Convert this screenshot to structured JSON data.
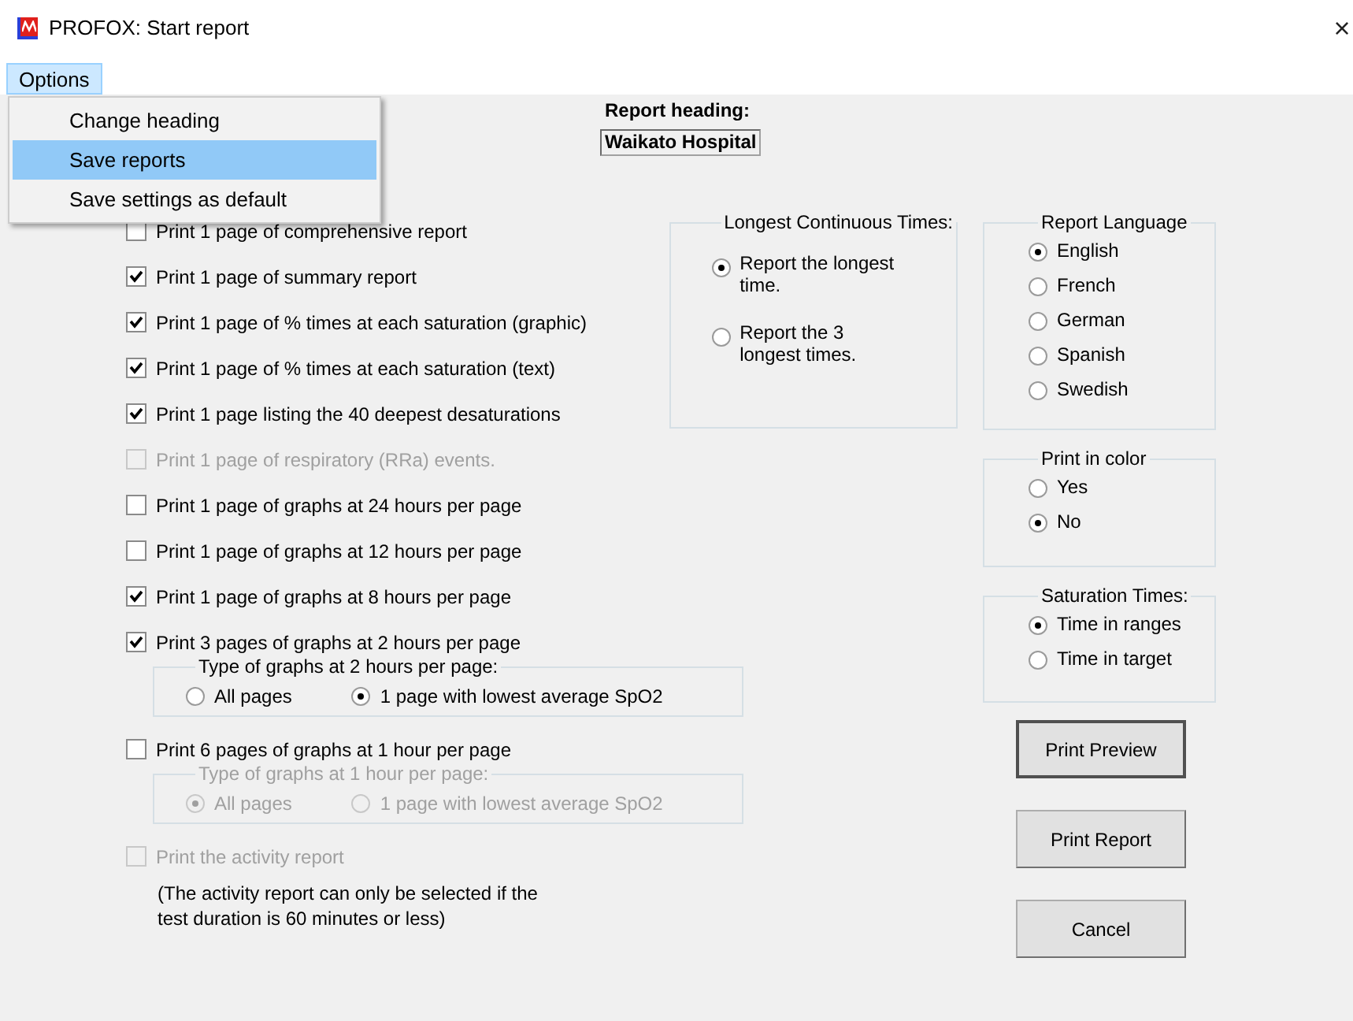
{
  "window": {
    "title": "PROFOX: Start report",
    "close": "×"
  },
  "menu_bar": [
    {
      "label": "Options",
      "selected": true
    }
  ],
  "menu": {
    "items": [
      {
        "label": "Change heading",
        "selected": false
      },
      {
        "label": "Save reports",
        "selected": true
      },
      {
        "label": "Save settings as default",
        "selected": false
      }
    ]
  },
  "report_heading": {
    "label": "Report heading:",
    "value": "Waikato Hospital"
  },
  "print_options": [
    {
      "kind": "checkbox",
      "label": "Print 1 page of comprehensive report",
      "checked": false,
      "disabled": false
    },
    {
      "kind": "checkbox",
      "label": "Print 1 page of summary report",
      "checked": true,
      "disabled": false
    },
    {
      "kind": "checkbox",
      "label": "Print 1 page of % times at each saturation (graphic)",
      "checked": true,
      "disabled": false
    },
    {
      "kind": "checkbox",
      "label": "Print 1 page of % times at each saturation (text)",
      "checked": true,
      "disabled": false
    },
    {
      "kind": "checkbox",
      "label": "Print 1 page listing the 40 deepest desaturations",
      "checked": true,
      "disabled": false
    },
    {
      "kind": "checkbox",
      "label": "Print 1 page of respiratory (RRa) events.",
      "checked": false,
      "disabled": true
    },
    {
      "kind": "checkbox",
      "label": "Print 1 page of graphs at 24 hours per page",
      "checked": false,
      "disabled": false
    },
    {
      "kind": "checkbox",
      "label": "Print 1 page of graphs at 12 hours per page",
      "checked": false,
      "disabled": false
    },
    {
      "kind": "checkbox",
      "label": "Print 1 page of graphs at 8 hours per page",
      "checked": true,
      "disabled": false
    },
    {
      "kind": "checkbox",
      "label": "Print 3 pages of graphs at 2 hours per page",
      "checked": true,
      "disabled": false
    },
    {
      "kind": "group",
      "legend": "Type of graphs at 2 hours per page:",
      "disabled": false,
      "options": [
        {
          "label": "All pages",
          "selected": false
        },
        {
          "label": "1 page with lowest average SpO2",
          "selected": true
        }
      ]
    },
    {
      "kind": "checkbox",
      "label": "Print 6 pages of graphs at 1 hour per page",
      "checked": false,
      "disabled": false
    },
    {
      "kind": "group",
      "legend": "Type of graphs at 1 hour per page:",
      "disabled": true,
      "options": [
        {
          "label": "All pages",
          "selected": true
        },
        {
          "label": "1 page with lowest average SpO2",
          "selected": false
        }
      ]
    },
    {
      "kind": "checkbox",
      "label": "Print the activity report",
      "checked": false,
      "disabled": true
    },
    {
      "kind": "note",
      "lines": [
        "(The activity report can only be selected if the",
        "test duration is 60 minutes or less)"
      ]
    }
  ],
  "longest_times": {
    "legend": "Longest Continuous Times:",
    "options": [
      {
        "label": "Report the longest time.",
        "selected": true
      },
      {
        "label": "Report the 3 longest times.",
        "selected": false
      }
    ]
  },
  "right_groups": [
    {
      "legend": "Report Language",
      "options": [
        {
          "label": "English",
          "selected": true
        },
        {
          "label": "French",
          "selected": false
        },
        {
          "label": "German",
          "selected": false
        },
        {
          "label": "Spanish",
          "selected": false
        },
        {
          "label": "Swedish",
          "selected": false
        }
      ]
    },
    {
      "legend": "Print in color",
      "options": [
        {
          "label": "Yes",
          "selected": false
        },
        {
          "label": "No",
          "selected": true
        }
      ]
    },
    {
      "legend": "Saturation Times:",
      "options": [
        {
          "label": "Time in ranges",
          "selected": true
        },
        {
          "label": "Time in target",
          "selected": false
        }
      ]
    }
  ],
  "buttons": [
    {
      "label": "Print Preview",
      "default": true
    },
    {
      "label": "Print Report",
      "default": false
    },
    {
      "label": "Cancel",
      "default": false
    }
  ]
}
